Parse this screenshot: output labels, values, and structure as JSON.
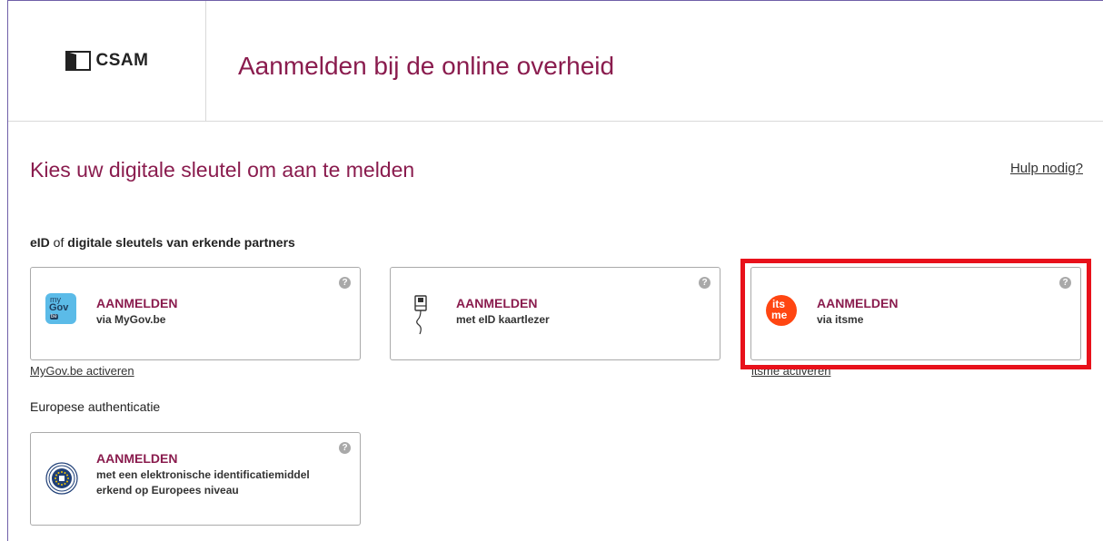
{
  "header": {
    "logo_text": "CSAM",
    "title": "Aanmelden bij de online overheid"
  },
  "main": {
    "heading": "Kies uw digitale sleutel om aan te melden",
    "help_link": "Hulp nodig?",
    "section1": {
      "label_bold1": "eID",
      "label_mid": " of ",
      "label_bold2": "digitale sleutels van erkende partners"
    },
    "section2": {
      "label": "Europese authenticatie"
    },
    "cards": [
      {
        "title": "AANMELDEN",
        "subtitle": "via MyGov.be",
        "link": "MyGov.be activeren",
        "icon": "mygov-icon",
        "icon_text_1": "my",
        "icon_text_2": "Gov",
        "icon_text_3": "be"
      },
      {
        "title": "AANMELDEN",
        "subtitle": "met eID kaartlezer",
        "icon": "card-reader-icon"
      },
      {
        "title": "AANMELDEN",
        "subtitle": "via itsme",
        "link": "itsme activeren",
        "icon": "itsme-icon",
        "icon_text_1": "its",
        "icon_text_2": "me"
      },
      {
        "title": "AANMELDEN",
        "subtitle_line1": "met een elektronische identificatiemiddel",
        "subtitle_line2": "erkend op Europees niveau",
        "icon": "eu-eid-icon"
      }
    ],
    "help_glyph": "?"
  },
  "colors": {
    "brand": "#8a1c4e",
    "highlight": "#e8111b",
    "mygov": "#5bbbe8",
    "itsme": "#ff4612"
  }
}
